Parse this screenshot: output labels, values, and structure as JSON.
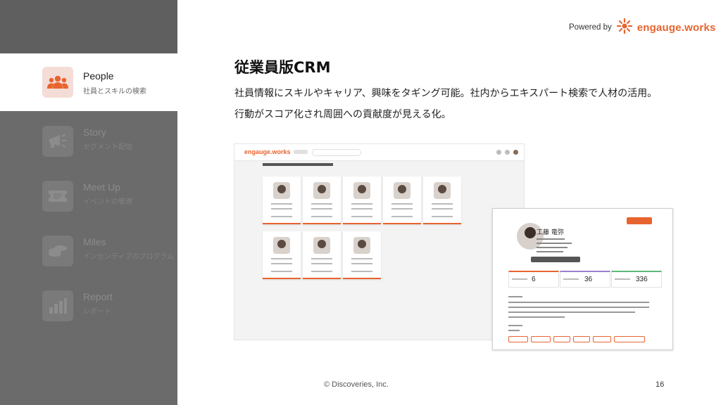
{
  "header": {
    "powered_by": "Powered by",
    "brand": "engauge.works"
  },
  "sidebar": {
    "items": [
      {
        "title": "People",
        "subtitle": "社員とスキルの検索",
        "icon": "people-icon",
        "active": true
      },
      {
        "title": "Story",
        "subtitle": "セグメント配信",
        "icon": "megaphone-icon",
        "active": false
      },
      {
        "title": "Meet Up",
        "subtitle": "イベントの管理",
        "icon": "ticket-icon",
        "active": false
      },
      {
        "title": "Miles",
        "subtitle": "インセンティブのプログラム",
        "icon": "coins-icon",
        "active": false
      },
      {
        "title": "Report",
        "subtitle": "レポート",
        "icon": "bar-chart-icon",
        "active": false
      }
    ]
  },
  "main": {
    "title": "従業員版CRM",
    "line1": "社員情報にスキルやキャリア、興味をタギング可能。社内からエキスパート検索で人材の活用。",
    "line2": "行動がスコア化され周囲への貢献度が見える化。"
  },
  "mock_list": {
    "brand": "engauge.works"
  },
  "mock_detail": {
    "name": "工藤 竜弥",
    "stats": [
      "6",
      "36",
      "336"
    ]
  },
  "footer": {
    "copyright": "© Discoveries, Inc.",
    "page": "16"
  },
  "colors": {
    "accent": "#e8642f",
    "sidebar": "#6b6b6b"
  }
}
